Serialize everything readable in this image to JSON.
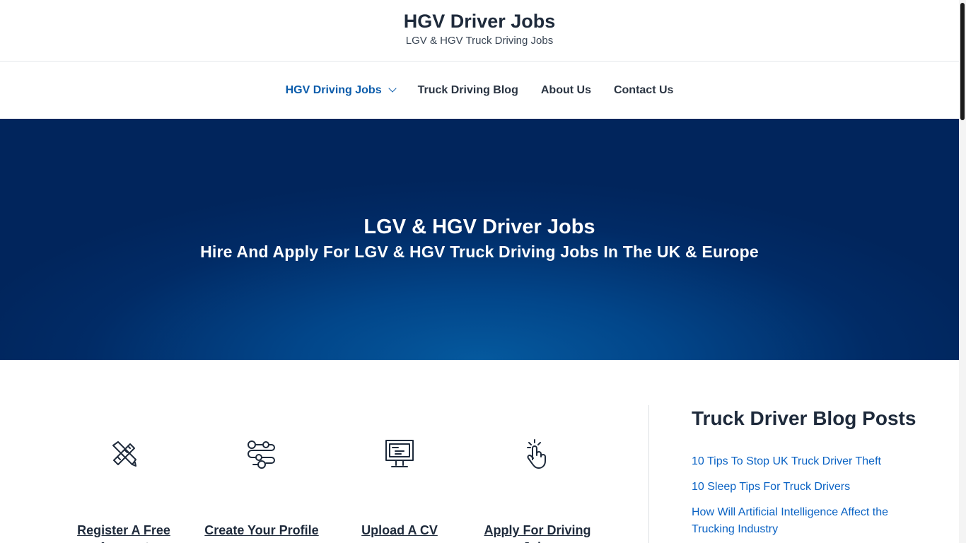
{
  "header": {
    "site_title": "HGV Driver Jobs",
    "tagline": "LGV & HGV Truck Driving Jobs"
  },
  "nav": {
    "items": [
      {
        "label": "HGV Driving Jobs",
        "active": true,
        "has_dropdown": true
      },
      {
        "label": "Truck Driving Blog"
      },
      {
        "label": "About Us"
      },
      {
        "label": "Contact Us"
      }
    ]
  },
  "hero": {
    "title": "LGV & HGV Driver Jobs",
    "subtitle": "Hire And Apply For LGV & HGV Truck Driving Jobs In The UK & Europe"
  },
  "steps": [
    {
      "icon": "pencil-ruler-icon",
      "label": "Register A Free Account"
    },
    {
      "icon": "flow-settings-icon",
      "label": "Create Your Profile"
    },
    {
      "icon": "monitor-icon",
      "label": "Upload A CV"
    },
    {
      "icon": "hand-tap-icon",
      "label": "Apply For Driving Jobs"
    }
  ],
  "sidebar": {
    "heading": "Truck Driver Blog Posts",
    "posts": [
      "10 Tips To Stop UK Truck Driver Theft",
      "10 Sleep Tips For Truck Drivers",
      "How Will Artificial Intelligence Affect the Trucking Industry"
    ]
  },
  "colors": {
    "brand_blue": "#0b5cab",
    "link_blue": "#0b63c4",
    "hero_dark": "#01255c",
    "hero_light": "#05599e",
    "text_dark": "#1e2a3b"
  }
}
